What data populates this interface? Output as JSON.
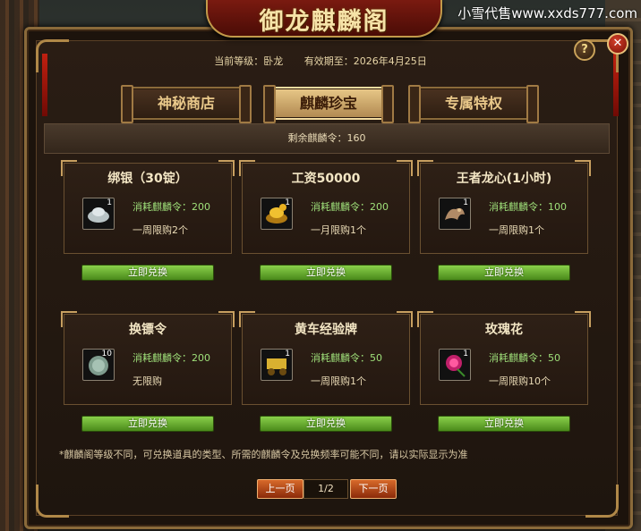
{
  "watermark": "小雪代售www.xxds777.com",
  "title": "御龙麒麟阁",
  "header": {
    "level_label": "当前等级：卧龙",
    "expiry_label": "有效期至：2026年4月25日"
  },
  "controls": {
    "help": "?",
    "close": "✕"
  },
  "tabs": [
    {
      "label": "神秘商店",
      "active": false
    },
    {
      "label": "麒麟珍宝",
      "active": true
    },
    {
      "label": "专属特权",
      "active": false
    }
  ],
  "remaining": "剩余麒麟令：160",
  "items": [
    {
      "name": "绑银（30锭）",
      "count": "1",
      "cost": "消耗麒麟令：200",
      "limit": "一周限购2个",
      "button": "立即兑换",
      "icon": "silver-ingot-icon",
      "color": "#9aa6a8"
    },
    {
      "name": "工资50000",
      "count": "1",
      "cost": "消耗麒麟令：200",
      "limit": "一月限购1个",
      "button": "立即兑换",
      "icon": "gold-ingot-icon",
      "color": "#d8a82a"
    },
    {
      "name": "王者龙心(1小时)",
      "count": "1",
      "cost": "消耗麒麟令：100",
      "limit": "一周限购1个",
      "button": "立即兑换",
      "icon": "dragon-heart-icon",
      "color": "#a87a5a"
    },
    {
      "name": "换镖令",
      "count": "10",
      "cost": "消耗麒麟令：200",
      "limit": "无限购",
      "button": "立即兑换",
      "icon": "escort-token-icon",
      "color": "#7a9a8a"
    },
    {
      "name": "黄车经验牌",
      "count": "1",
      "cost": "消耗麒麟令：50",
      "limit": "一周限购1个",
      "button": "立即兑换",
      "icon": "yellow-cart-exp-icon",
      "color": "#c8a030"
    },
    {
      "name": "玫瑰花",
      "count": "1",
      "cost": "消耗麒麟令：50",
      "limit": "一周限购10个",
      "button": "立即兑换",
      "icon": "rose-icon",
      "color": "#c0206a"
    }
  ],
  "note": "*麒麟阁等级不同，可兑换道具的类型、所需的麒麟令及兑换频率可能不同，请以实际显示为准",
  "pager": {
    "prev": "上一页",
    "page": "1/2",
    "next": "下一页"
  }
}
